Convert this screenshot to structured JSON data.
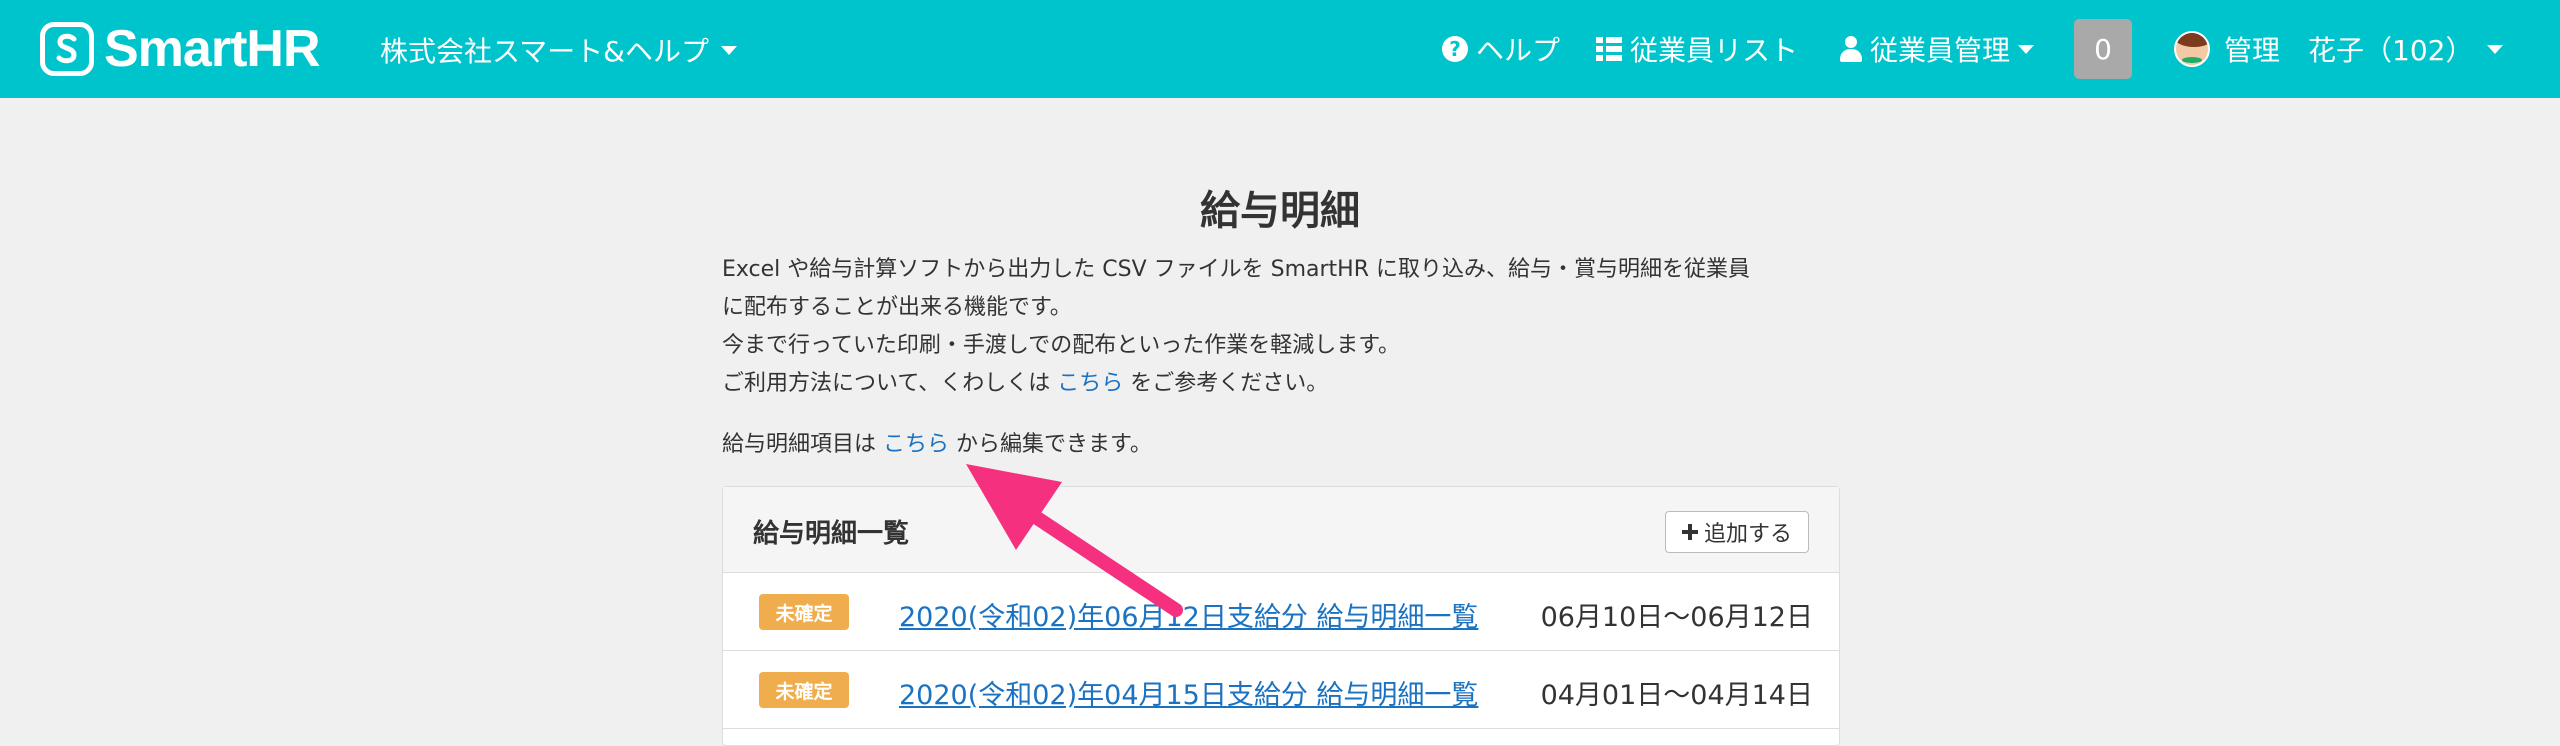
{
  "header": {
    "logo_text": "SmartHR",
    "company": "株式会社スマート&ヘルプ",
    "help_label": "ヘルプ",
    "employee_list_label": "従業員リスト",
    "employee_mgmt_label": "従業員管理",
    "notification_count": "0",
    "user_name": "管理　花子（102）",
    "accent_color": "#00c4cc"
  },
  "page": {
    "title": "給与明細",
    "desc_line1": "Excel や給与計算ソフトから出力した CSV ファイルを SmartHR に取り込み、給与・賞与明細を従業員",
    "desc_line2": "に配布することが出来る機能です。",
    "desc_line3": "今まで行っていた印刷・手渡しでの配布といった作業を軽減します。",
    "desc_line4_pre": "ご利用方法について、くわしくは",
    "desc_line4_link": "こちら",
    "desc_line4_post": "をご参考ください。",
    "edit_pre": "給与明細項目は",
    "edit_link": "こちら",
    "edit_post": "から編集できます。"
  },
  "panel": {
    "title": "給与明細一覧",
    "add_label": "追加する",
    "rows": [
      {
        "status": "未確定",
        "link": "2020(令和02)年06月12日支給分 給与明細一覧",
        "range": "06月10日〜06月12日"
      },
      {
        "status": "未確定",
        "link": "2020(令和02)年04月15日支給分 給与明細一覧",
        "range": "04月01日〜04月14日"
      }
    ]
  },
  "annotation": {
    "arrow_color": "#f5317f"
  }
}
